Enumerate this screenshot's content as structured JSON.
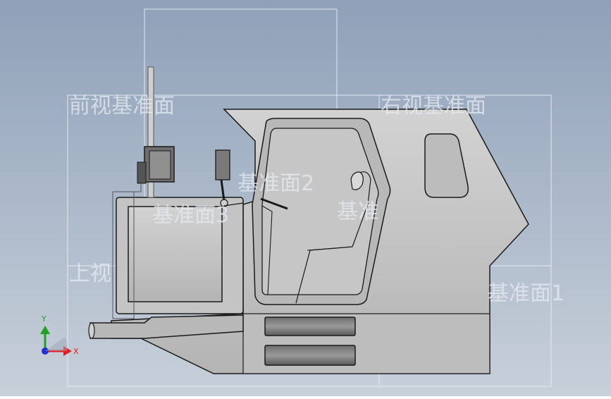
{
  "planes": {
    "front": "前视基准面",
    "right": "右视基准面",
    "top": "上视",
    "plane1": "基准面1",
    "plane2": "基准面2",
    "plane3": "基准面3",
    "plane4": "基准"
  },
  "triad": {
    "y_label": "Y",
    "x_label": "X"
  },
  "colors": {
    "background_top": "#8fa0b8",
    "background_bottom": "#c8d0da",
    "body_fill": "#c0c0c0",
    "edge": "#1a1a1a",
    "plane_outline": "#e4e9f0",
    "axis_x": "#e02020",
    "axis_y": "#20a020",
    "axis_z": "#2030d0"
  }
}
